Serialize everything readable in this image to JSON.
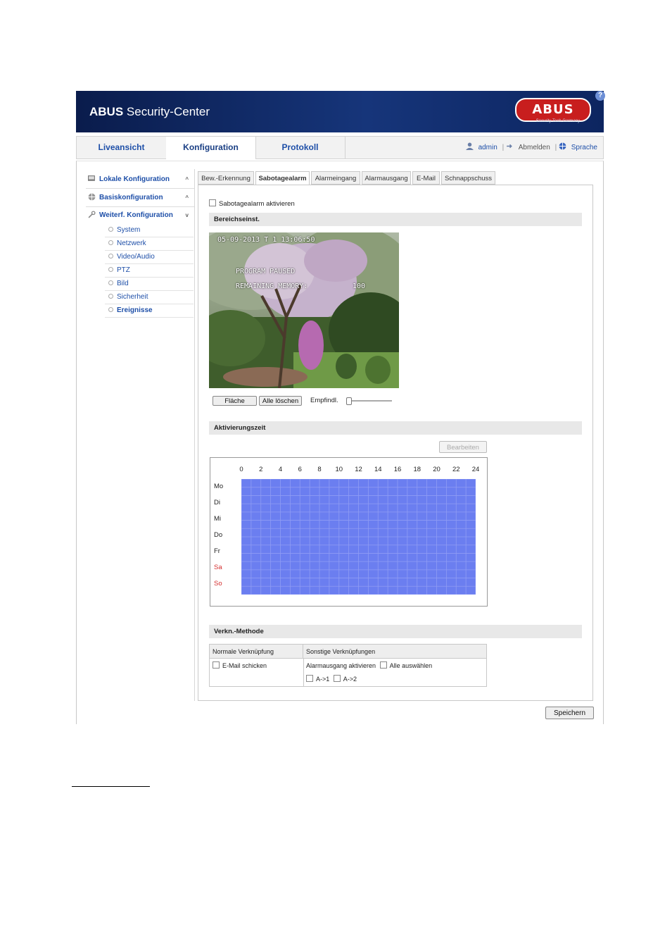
{
  "header": {
    "title_bold": "ABUS",
    "title_rest": " Security-Center",
    "logo_text": "ABUS",
    "logo_sub": "Security Tech Germany",
    "help_icon": "question-icon"
  },
  "nav": {
    "tabs": [
      {
        "label": "Liveansicht"
      },
      {
        "label": "Konfiguration"
      },
      {
        "label": "Protokoll"
      }
    ],
    "user": "admin",
    "logout": "Abmelden",
    "language": "Sprache"
  },
  "sidebar": {
    "groups": [
      {
        "label": "Lokale Konfiguration",
        "icon": "local-config-icon"
      },
      {
        "label": "Basiskonfiguration",
        "icon": "globe-icon"
      },
      {
        "label": "Weiterf. Konfiguration",
        "icon": "wrench-icon"
      }
    ],
    "items": [
      {
        "label": "System"
      },
      {
        "label": "Netzwerk"
      },
      {
        "label": "Video/Audio"
      },
      {
        "label": "PTZ"
      },
      {
        "label": "Bild"
      },
      {
        "label": "Sicherheit"
      },
      {
        "label": "Ereignisse"
      }
    ]
  },
  "tabs": [
    {
      "label": "Bew.-Erkennung"
    },
    {
      "label": "Sabotagealarm"
    },
    {
      "label": "Alarmeingang"
    },
    {
      "label": "Alarmausgang"
    },
    {
      "label": "E-Mail"
    },
    {
      "label": "Schnappschuss"
    }
  ],
  "content": {
    "enable_label": "Sabotagealarm aktivieren",
    "area_section": "Bereichseinst.",
    "camera": {
      "osd_line1": "05-09-2013 T 1 13:06:50",
      "osd_line2": "PROGRAM PAUSED",
      "osd_line3": "REMAINING MEMORY:",
      "osd_value": "100"
    },
    "area_button": "Fläche",
    "clear_button": "Alle löschen",
    "sensitivity_label": "Empfindl.",
    "sensitivity_level": 0,
    "activation_section": "Aktivierungszeit",
    "edit_button": "Bearbeiten",
    "schedule": {
      "hours": [
        "0",
        "2",
        "4",
        "6",
        "8",
        "10",
        "12",
        "14",
        "16",
        "18",
        "20",
        "22",
        "24"
      ],
      "days": [
        "Mo",
        "Di",
        "Mi",
        "Do",
        "Fr",
        "Sa",
        "So"
      ],
      "active_color": "#6b7ef0",
      "weekend_color": "#d42f2f"
    },
    "link_section": "Verkn.-Methode",
    "link_table": {
      "col1_header": "Normale Verknüpfung",
      "col2_header": "Sonstige Verknüpfungen",
      "email_label": "E-Mail schicken",
      "alarm_out_label": "Alarmausgang aktivieren",
      "select_all_label": "Alle auswählen",
      "out1": "A->1",
      "out2": "A->2"
    },
    "save_button": "Speichern"
  }
}
